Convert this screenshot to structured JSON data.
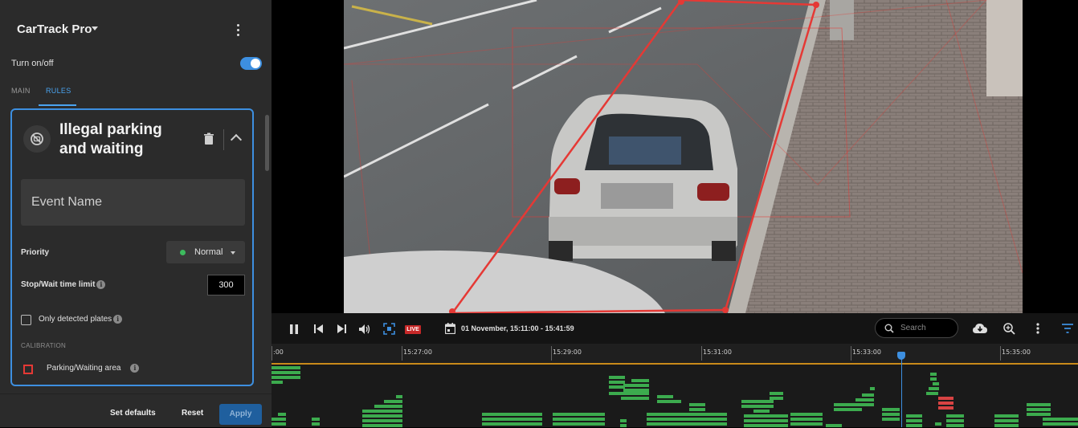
{
  "app": {
    "title": "CarTrack Pro"
  },
  "toggle": {
    "label": "Turn on/off",
    "on": true
  },
  "tabs": [
    {
      "label": "MAIN",
      "active": false
    },
    {
      "label": "RULES",
      "active": true
    }
  ],
  "rule": {
    "title": "Illegal parking and waiting",
    "event_name_placeholder": "Event Name",
    "priority_label": "Priority",
    "priority_value": "Normal",
    "time_limit_label": "Stop/Wait time limit",
    "time_limit_value": "300",
    "only_plates_label": "Only detected plates",
    "only_plates_checked": false,
    "calibration_label": "CALIBRATION",
    "area_label": "Parking/Waiting area"
  },
  "footer": {
    "set_defaults": "Set defaults",
    "reset": "Reset",
    "apply": "Apply"
  },
  "player": {
    "date_range": "01 November, 15:11:00 - 15:41:59",
    "live_label": "LIVE",
    "search_placeholder": "Search"
  },
  "timeline": {
    "ticks": [
      ":00",
      "15:27:00",
      "15:29:00",
      "15:31:00",
      "15:33:00",
      "15:35:00"
    ]
  },
  "colors": {
    "accent": "#3d8fe0",
    "zone": "#e53935",
    "event_green": "#3cab4e",
    "event_red": "#d84343",
    "timeline_range": "#c98a1a"
  }
}
